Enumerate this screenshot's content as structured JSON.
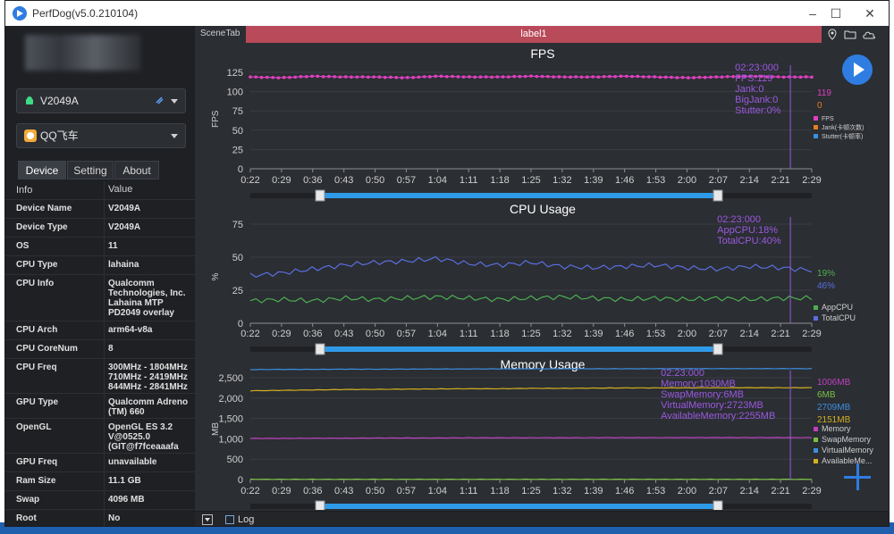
{
  "window": {
    "title": "PerfDog(v5.0.210104)"
  },
  "device_select": {
    "value": "V2049A"
  },
  "app_select": {
    "value": "QQ飞车"
  },
  "tabs": [
    {
      "label": "Device"
    },
    {
      "label": "Setting"
    },
    {
      "label": "About"
    }
  ],
  "info": {
    "header": {
      "key": "Info",
      "value": "Value"
    },
    "rows": [
      {
        "key": "Device Name",
        "value": "V2049A"
      },
      {
        "key": "Device Type",
        "value": "V2049A"
      },
      {
        "key": "OS",
        "value": "11"
      },
      {
        "key": "CPU Type",
        "value": "lahaina"
      },
      {
        "key": "CPU Info",
        "value": "Qualcomm Technologies, Inc. Lahaina MTP PD2049 overlay"
      },
      {
        "key": "CPU Arch",
        "value": "arm64-v8a"
      },
      {
        "key": "CPU CoreNum",
        "value": "8"
      },
      {
        "key": "CPU Freq",
        "value": "300MHz - 1804MHz 710MHz - 2419MHz 844MHz - 2841MHz"
      },
      {
        "key": "GPU Type",
        "value": "Qualcomm Adreno (TM) 660"
      },
      {
        "key": "OpenGL",
        "value": "OpenGL ES 3.2 V@0525.0 (GIT@f7fceaaafa"
      },
      {
        "key": "GPU Freq",
        "value": "unavailable"
      },
      {
        "key": "Ram Size",
        "value": "11.1 GB"
      },
      {
        "key": "Swap",
        "value": "4096 MB"
      },
      {
        "key": "Root",
        "value": "No"
      }
    ]
  },
  "scene": {
    "tab_label": "SceneTab",
    "label": "label1"
  },
  "bottom": {
    "log_label": "Log"
  },
  "colors": {
    "fps": "#e040c0",
    "cpu_app": "#4caf50",
    "cpu_total": "#5b6ee0",
    "mem": "#c040c0",
    "swap": "#7ac143",
    "virtual": "#3b8fe0",
    "available": "#d4b020",
    "tooltip": "#9b59e0"
  },
  "x_ticks": [
    "0:22",
    "0:29",
    "0:36",
    "0:43",
    "0:50",
    "0:57",
    "1:04",
    "1:11",
    "1:18",
    "1:25",
    "1:32",
    "1:39",
    "1:46",
    "1:53",
    "2:00",
    "2:07",
    "2:14",
    "2:21",
    "2:29"
  ],
  "chart_data": [
    {
      "type": "line",
      "title": "FPS",
      "ylabel": "FPS",
      "ylim": [
        0,
        125
      ],
      "yticks": [
        "0",
        "25",
        "50",
        "75",
        "100",
        "125"
      ],
      "series": [
        {
          "name": "FPS",
          "values": [
            119,
            118,
            120,
            119,
            119,
            118,
            120,
            119,
            119,
            120,
            119,
            119,
            120,
            119,
            118,
            119,
            120,
            119,
            119
          ]
        }
      ],
      "tooltip": [
        "02:23:000",
        "FPS:119",
        "Jank:0",
        "BigJank:0",
        "Stutter:0%"
      ],
      "current_values": [
        "119",
        "0"
      ],
      "legend": [
        "FPS",
        "Jank(卡顿次数)",
        "Stutter(卡顿率)"
      ]
    },
    {
      "type": "line",
      "title": "CPU Usage",
      "ylabel": "%",
      "ylim": [
        0,
        75
      ],
      "yticks": [
        "0",
        "25",
        "50",
        "75"
      ],
      "series": [
        {
          "name": "AppCPU",
          "values": [
            17,
            18,
            17,
            19,
            18,
            19,
            20,
            19,
            18,
            19,
            20,
            19,
            18,
            19,
            18,
            19,
            18,
            19,
            19
          ]
        },
        {
          "name": "TotalCPU",
          "values": [
            36,
            38,
            41,
            44,
            46,
            47,
            49,
            45,
            44,
            46,
            43,
            42,
            43,
            44,
            42,
            41,
            43,
            42,
            40
          ]
        }
      ],
      "tooltip": [
        "02:23:000",
        "AppCPU:18%",
        "TotalCPU:40%"
      ],
      "current_values": [
        "19%",
        "46%"
      ],
      "legend": [
        "AppCPU",
        "TotalCPU"
      ]
    },
    {
      "type": "line",
      "title": "Memory Usage",
      "ylabel": "MB",
      "ylim": [
        0,
        2500
      ],
      "yticks": [
        "0",
        "500",
        "1,000",
        "1,500",
        "2,000",
        "2,500"
      ],
      "series": [
        {
          "name": "Memory",
          "values": [
            1010,
            1010,
            1015,
            1015,
            1020,
            1020,
            1020,
            1025,
            1025,
            1025,
            1025,
            1028,
            1028,
            1028,
            1030,
            1030,
            1030,
            1030,
            1030
          ]
        },
        {
          "name": "SwapMemory",
          "values": [
            6,
            6,
            6,
            6,
            6,
            6,
            6,
            6,
            6,
            6,
            6,
            6,
            6,
            6,
            6,
            6,
            6,
            6,
            6
          ]
        },
        {
          "name": "VirtualMemory",
          "values": [
            2700,
            2705,
            2705,
            2710,
            2710,
            2712,
            2715,
            2715,
            2718,
            2718,
            2720,
            2720,
            2720,
            2722,
            2722,
            2723,
            2723,
            2723,
            2723
          ]
        },
        {
          "name": "AvailableMemory",
          "values": [
            2180,
            2190,
            2200,
            2210,
            2215,
            2220,
            2225,
            2230,
            2230,
            2240,
            2240,
            2245,
            2250,
            2250,
            2252,
            2254,
            2255,
            2255,
            2255
          ]
        }
      ],
      "tooltip": [
        "02:23:000",
        "Memory:1030MB",
        "SwapMemory:6MB",
        "VirtualMemory:2723MB",
        "AvailableMemory:2255MB"
      ],
      "current_values": [
        "1006MB",
        "6MB",
        "2709MB",
        "2151MB"
      ],
      "legend": [
        "Memory",
        "SwapMemory",
        "VirtualMemory",
        "AvailableMe..."
      ]
    }
  ]
}
